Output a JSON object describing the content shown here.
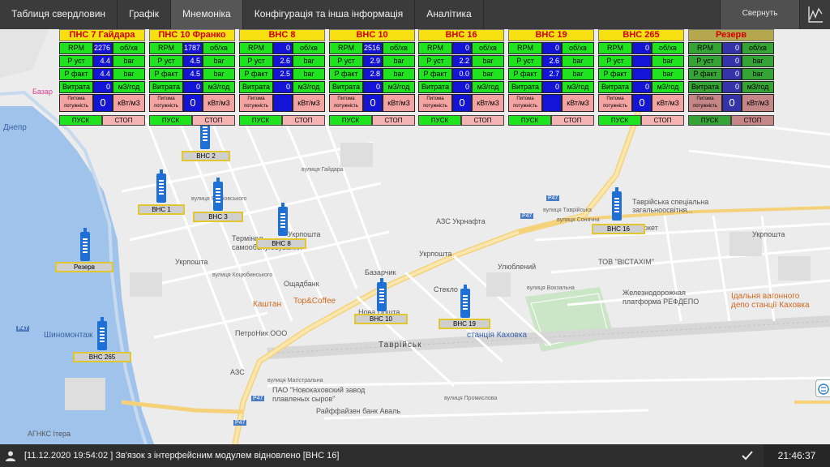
{
  "tabs": [
    {
      "label": "Таблиця свердловин",
      "active": false
    },
    {
      "label": "Графік",
      "active": false
    },
    {
      "label": "Мнемоніка",
      "active": true
    },
    {
      "label": "Конфігурація та інша інформація",
      "active": false
    },
    {
      "label": "Аналітика",
      "active": false
    }
  ],
  "collapse_label": "Свернуть",
  "row_labels": {
    "rpm": "RPM",
    "p_set": "Р уст",
    "p_fact": "Р факт",
    "flow": "Витрата",
    "power": "Питома потужність"
  },
  "units": {
    "rpm": "об/хв",
    "pressure": "bar",
    "flow": "м3/год",
    "power": "кВт/м3"
  },
  "buttons": {
    "start": "ПУСК",
    "stop": "СТОП"
  },
  "panels": [
    {
      "title": "ПНС 7 Гайдара",
      "rpm": "2276",
      "p_set": "4.4",
      "p_fact": "4.4",
      "flow": "0",
      "power": "0"
    },
    {
      "title": "ПНС 10 Франко",
      "rpm": "1787",
      "p_set": "4.5",
      "p_fact": "4.5",
      "flow": "0",
      "power": "0"
    },
    {
      "title": "ВНС 8",
      "rpm": "0",
      "p_set": "2.6",
      "p_fact": "2.5",
      "flow": "0",
      "power": ""
    },
    {
      "title": "ВНС 10",
      "rpm": "2516",
      "p_set": "2.9",
      "p_fact": "2.8",
      "flow": "0",
      "power": "0"
    },
    {
      "title": "ВНС 16",
      "rpm": "0",
      "p_set": "2.2",
      "p_fact": "0.0",
      "flow": "0",
      "power": "0"
    },
    {
      "title": "ВНС 19",
      "rpm": "0",
      "p_set": "2.6",
      "p_fact": "2.7",
      "flow": "0",
      "power": ""
    },
    {
      "title": "ВНС 265",
      "rpm": "0",
      "p_set": "",
      "p_fact": "",
      "flow": "0",
      "power": "0"
    },
    {
      "title": "Резерв",
      "rpm": "0",
      "p_set": "0",
      "p_fact": "0",
      "flow": "0",
      "power": "0",
      "reserve": true
    }
  ],
  "wells": [
    {
      "label": "ВНС 2"
    },
    {
      "label": "ВНС 1"
    },
    {
      "label": "ВНС 3"
    },
    {
      "label": "ВНС 8"
    },
    {
      "label": "Резерв"
    },
    {
      "label": "ВНС 265"
    },
    {
      "label": "ВНС 10"
    },
    {
      "label": "ВНС 19"
    },
    {
      "label": "ВНС 16"
    }
  ],
  "map_labels": {
    "azs_ukrnafta": "АЗС Укрнафта",
    "school": "Таврійська спеціальна загальноосвітня...",
    "market": "ркет",
    "ukrposhta_1": "Укрпошта",
    "ukrposhta_2": "Укрпошта",
    "ukrposhta_3": "Укрпошта",
    "ukrposhta_4": "Укрпошта",
    "terminal": "Термінал самообслуговування",
    "oschadbank": "Ощадбанк",
    "bazarchik": "Базарчик",
    "ulyubleniy": "Улюблений",
    "vistakhim": "ТОВ \"ВІСТАХІМ\"",
    "steklo": "Стекло",
    "novaposhta": "Нова Пошта",
    "kashtan": "Каштан",
    "topcoffee": "Top&Coffee",
    "petronik": "ПетроНик ООО",
    "shynomontazh": "Шиномонтаж",
    "tavriysk": "Таврійськ",
    "station": "станція Каховка",
    "platform": "Железнодорожная платформа РЕФДЕПО",
    "depo": "Ідальня вагонного депо станції Каховка",
    "azs": "АЗС",
    "plant": "ПАО \"Новокаховский завод плавленых сыров\"",
    "raiffeisen": "Райффайзен банк Аваль",
    "agnks": "АГНКС Ітера",
    "p47_1": "P47",
    "p47_2": "P47",
    "p47_3": "P47",
    "p47_4": "P47",
    "p47_5": "P47",
    "bazar_left": "Базар",
    "dnipro": "Днепр",
    "street_tavriyska": "вулиця Таврійська",
    "street_vokzalna": "вулиця Вокзальна",
    "street_promyslova": "вулиця Промислова",
    "street_magistralna": "вулиця Магістральна",
    "street_kotsyubynskogo": "вулиця Коцюбинського",
    "street_sonyachna": "вулиця Сонячна",
    "street_gaidara": "вулиця Гайдара",
    "street_yakubovskogo": "вулиця Якубовського"
  },
  "status": {
    "message": "[11.12.2020 19:54:02 ] Зв'язок з інтерфейсним модулем відновлено [ВНС 16]",
    "time": "21:46:37"
  },
  "colors": {
    "topbar": "#3b3b3b",
    "panel_green": "#1fe31f",
    "panel_blue": "#1414d6",
    "panel_pink": "#f4a3a3",
    "title_yellow": "#f7e011",
    "title_red_text": "#d10000",
    "well_blue": "#1e6fd6"
  }
}
